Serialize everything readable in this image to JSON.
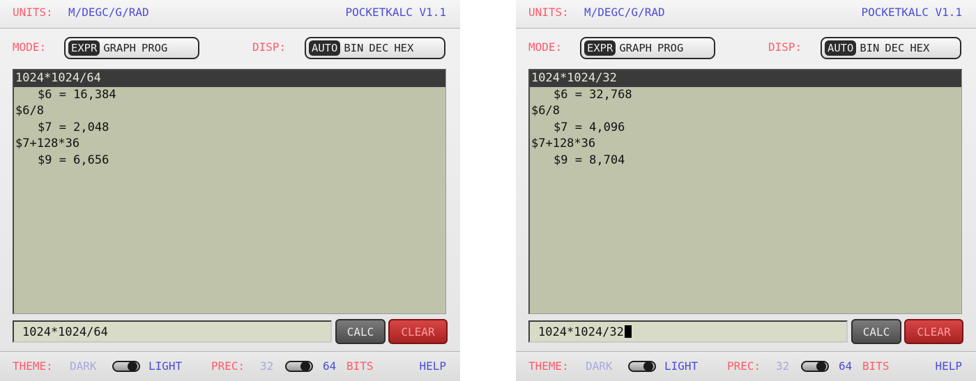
{
  "panels": [
    {
      "header": {
        "units_label": "UNITS:",
        "units_value": "M/DEGC/G/RAD",
        "version": "POCKETKALC V1.1"
      },
      "mode": {
        "label": "MODE:",
        "options": [
          "EXPR",
          "GRAPH",
          "PROG"
        ],
        "selected": "EXPR"
      },
      "disp": {
        "label": "DISP:",
        "options": [
          "AUTO",
          "BIN",
          "DEC",
          "HEX"
        ],
        "selected": "AUTO"
      },
      "history": [
        "1024*1024/64",
        "$6 = 16,384",
        "$6/8",
        "$7 = 2,048",
        "$7+128*36",
        "$9 = 6,656"
      ],
      "input_value": "1024*1024/64",
      "buttons": {
        "calc": "CALC",
        "clear": "CLEAR"
      },
      "footer": {
        "theme_label": "THEME:",
        "theme_dark": "DARK",
        "theme_light": "LIGHT",
        "prec_label": "PREC:",
        "prec_32": "32",
        "prec_64": "64",
        "prec_bits": "BITS",
        "help": "HELP"
      }
    },
    {
      "header": {
        "units_label": "UNITS:",
        "units_value": "M/DEGC/G/RAD",
        "version": "POCKETKALC V1.1"
      },
      "mode": {
        "label": "MODE:",
        "options": [
          "EXPR",
          "GRAPH",
          "PROG"
        ],
        "selected": "EXPR"
      },
      "disp": {
        "label": "DISP:",
        "options": [
          "AUTO",
          "BIN",
          "DEC",
          "HEX"
        ],
        "selected": "AUTO"
      },
      "history": [
        "1024*1024/32",
        "$6 = 32,768",
        "$6/8",
        "$7 = 4,096",
        "$7+128*36",
        "$9 = 8,704"
      ],
      "input_value": "1024*1024/32",
      "buttons": {
        "calc": "CALC",
        "clear": "CLEAR"
      },
      "footer": {
        "theme_label": "THEME:",
        "theme_dark": "DARK",
        "theme_light": "LIGHT",
        "prec_label": "PREC:",
        "prec_32": "32",
        "prec_64": "64",
        "prec_bits": "BITS",
        "help": "HELP"
      }
    }
  ],
  "colors": {
    "label_red": "#ff5a6a",
    "value_blue": "#4b4bd8",
    "lcd_background": "#bec3aa",
    "clear_button": "#c13333"
  }
}
